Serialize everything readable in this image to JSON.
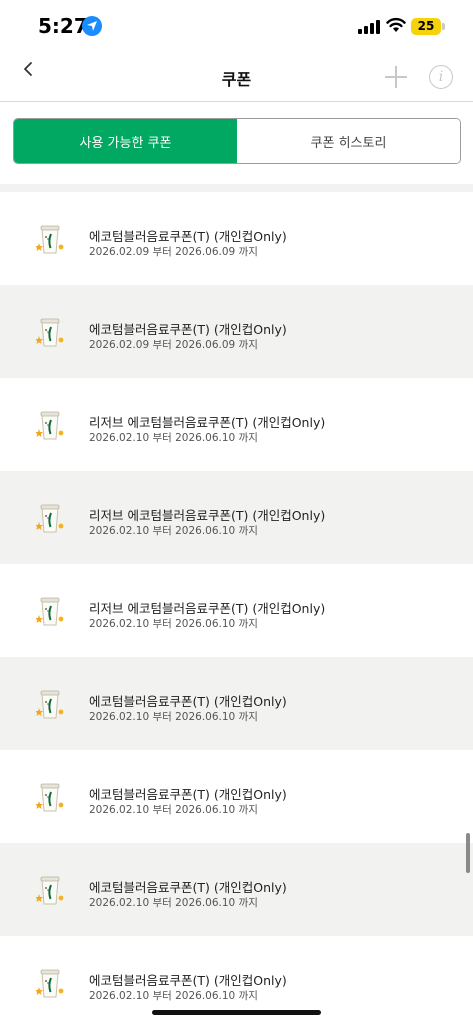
{
  "status_bar": {
    "time": "5:27",
    "battery": "25",
    "location_icon": "location-arrow-icon",
    "signal_icon": "cellular-signal-icon",
    "wifi_icon": "wifi-icon"
  },
  "nav": {
    "title": "쿠폰",
    "back_icon": "chevron-left-icon",
    "add_icon": "plus-icon",
    "info_icon": "info-icon",
    "info_glyph": "i"
  },
  "tabs": [
    {
      "label": "사용 가능한 쿠폰",
      "active": true
    },
    {
      "label": "쿠폰 히스토리",
      "active": false
    }
  ],
  "colors": {
    "accent": "#00a862",
    "alt_row": "#f2f2f0",
    "battery": "#f5d20a"
  },
  "coupons": [
    {
      "name": "에코텀블러음료쿠폰(T) (개인컵Only)",
      "period": "2026.02.09 부터 2026.06.09 까지",
      "icon": "cup-coupon-icon"
    },
    {
      "name": "에코텀블러음료쿠폰(T) (개인컵Only)",
      "period": "2026.02.09 부터 2026.06.09 까지",
      "icon": "cup-coupon-icon"
    },
    {
      "name": "리저브 에코텀블러음료쿠폰(T) (개인컵Only)",
      "period": "2026.02.10 부터 2026.06.10 까지",
      "icon": "cup-coupon-icon"
    },
    {
      "name": "리저브 에코텀블러음료쿠폰(T) (개인컵Only)",
      "period": "2026.02.10 부터 2026.06.10 까지",
      "icon": "cup-coupon-icon"
    },
    {
      "name": "리저브 에코텀블러음료쿠폰(T) (개인컵Only)",
      "period": "2026.02.10 부터 2026.06.10 까지",
      "icon": "cup-coupon-icon"
    },
    {
      "name": "에코텀블러음료쿠폰(T) (개인컵Only)",
      "period": "2026.02.10 부터 2026.06.10 까지",
      "icon": "cup-coupon-icon"
    },
    {
      "name": "에코텀블러음료쿠폰(T) (개인컵Only)",
      "period": "2026.02.10 부터 2026.06.10 까지",
      "icon": "cup-coupon-icon"
    },
    {
      "name": "에코텀블러음료쿠폰(T) (개인컵Only)",
      "period": "2026.02.10 부터 2026.06.10 까지",
      "icon": "cup-coupon-icon"
    },
    {
      "name": "에코텀블러음료쿠폰(T) (개인컵Only)",
      "period": "2026.02.10 부터 2026.06.10 까지",
      "icon": "cup-coupon-icon"
    }
  ]
}
